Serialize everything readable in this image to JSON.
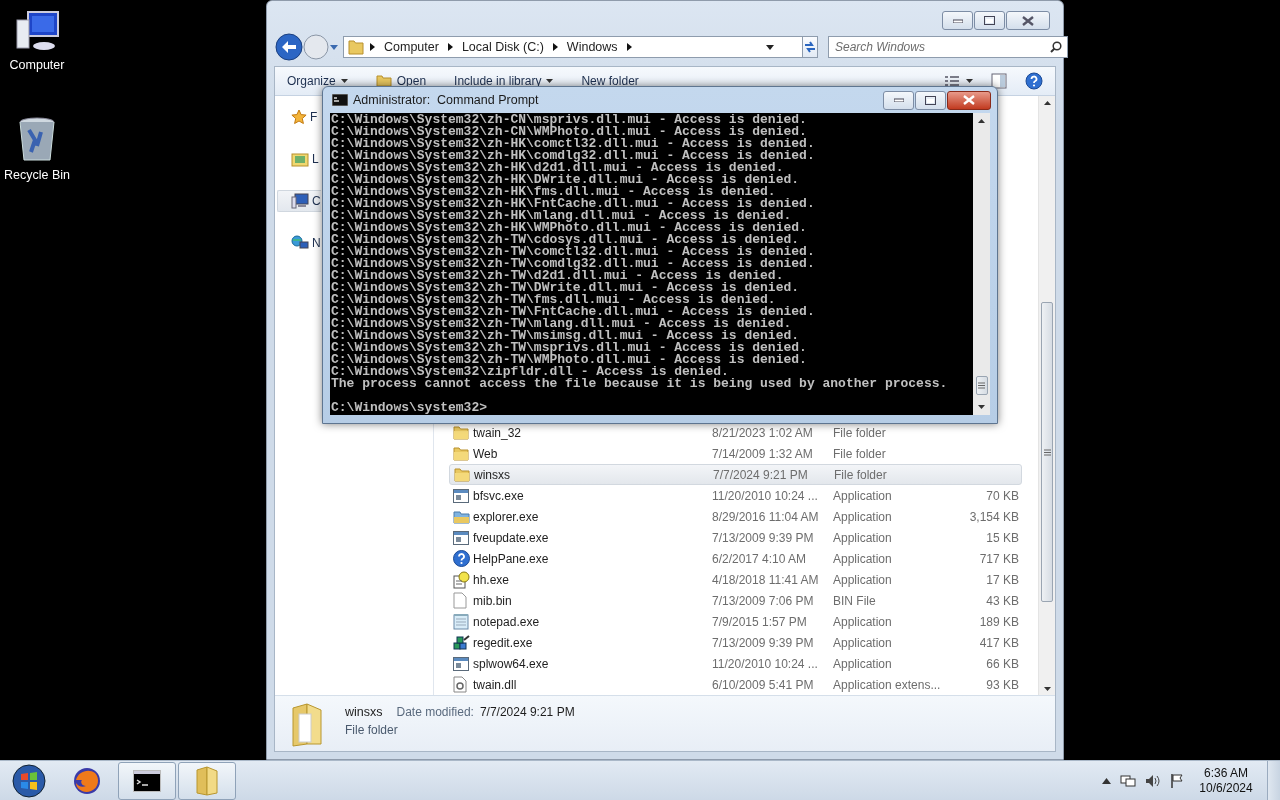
{
  "desktop": {
    "icons": [
      {
        "label": "Computer",
        "kind": "computer"
      },
      {
        "label": "Recycle Bin",
        "kind": "recycle"
      }
    ]
  },
  "explorer": {
    "breadcrumb": [
      "Computer",
      "Local Disk (C:)",
      "Windows"
    ],
    "search": {
      "placeholder": "Search Windows"
    },
    "toolbar": [
      {
        "label": "Organize",
        "kind": "menu"
      },
      {
        "label": "Open",
        "kind": "open"
      },
      {
        "label": "Include in library",
        "kind": "menu"
      },
      {
        "label": "New folder",
        "kind": "plain"
      }
    ],
    "nav": [
      {
        "label": "F",
        "kind": "favorites",
        "selected": false
      },
      {
        "label": "L",
        "kind": "libraries",
        "selected": false
      },
      {
        "label": "C",
        "kind": "computer",
        "selected": true
      },
      {
        "label": "N",
        "kind": "network",
        "selected": false
      }
    ],
    "files": [
      {
        "name": "twain_32",
        "date": "8/21/2023 1:02 AM",
        "type": "File folder",
        "kind": "folder",
        "selected": false
      },
      {
        "name": "Web",
        "date": "7/14/2009 1:32 AM",
        "type": "File folder",
        "kind": "folder",
        "selected": false
      },
      {
        "name": "winsxs",
        "date": "7/7/2024 9:21 PM",
        "type": "File folder",
        "kind": "folder",
        "selected": true
      },
      {
        "name": "bfsvc.exe",
        "date": "11/20/2010 10:24 ...",
        "type": "Application",
        "size": "70 KB",
        "kind": "app",
        "selected": false
      },
      {
        "name": "explorer.exe",
        "date": "8/29/2016 11:04 AM",
        "type": "Application",
        "size": "3,154 KB",
        "kind": "explorer",
        "selected": false
      },
      {
        "name": "fveupdate.exe",
        "date": "7/13/2009 9:39 PM",
        "type": "Application",
        "size": "15 KB",
        "kind": "app",
        "selected": false
      },
      {
        "name": "HelpPane.exe",
        "date": "6/2/2017 4:10 AM",
        "type": "Application",
        "size": "717 KB",
        "kind": "help",
        "selected": false
      },
      {
        "name": "hh.exe",
        "date": "4/18/2018 11:41 AM",
        "type": "Application",
        "size": "17 KB",
        "kind": "hh",
        "selected": false
      },
      {
        "name": "mib.bin",
        "date": "7/13/2009 7:06 PM",
        "type": "BIN File",
        "size": "43 KB",
        "kind": "file",
        "selected": false
      },
      {
        "name": "notepad.exe",
        "date": "7/9/2015 1:57 PM",
        "type": "Application",
        "size": "189 KB",
        "kind": "notepad",
        "selected": false
      },
      {
        "name": "regedit.exe",
        "date": "7/13/2009 9:39 PM",
        "type": "Application",
        "size": "417 KB",
        "kind": "regedit",
        "selected": false
      },
      {
        "name": "splwow64.exe",
        "date": "11/20/2010 10:24 ...",
        "type": "Application",
        "size": "66 KB",
        "kind": "app",
        "selected": false
      },
      {
        "name": "twain.dll",
        "date": "6/10/2009 5:41 PM",
        "type": "Application extens...",
        "size": "93 KB",
        "kind": "dll",
        "selected": false
      }
    ],
    "details": {
      "name": "winsxs",
      "date_label": "Date modified:",
      "date": "7/7/2024 9:21 PM",
      "type": "File folder"
    }
  },
  "console": {
    "title": "Administrator:  Command Prompt",
    "lines": [
      "C:\\Windows\\System32\\zh-CN\\msprivs.dll.mui - Access is denied.",
      "C:\\Windows\\System32\\zh-CN\\WMPhoto.dll.mui - Access is denied.",
      "C:\\Windows\\System32\\zh-HK\\comctl32.dll.mui - Access is denied.",
      "C:\\Windows\\System32\\zh-HK\\comdlg32.dll.mui - Access is denied.",
      "C:\\Windows\\System32\\zh-HK\\d2d1.dll.mui - Access is denied.",
      "C:\\Windows\\System32\\zh-HK\\DWrite.dll.mui - Access is denied.",
      "C:\\Windows\\System32\\zh-HK\\fms.dll.mui - Access is denied.",
      "C:\\Windows\\System32\\zh-HK\\FntCache.dll.mui - Access is denied.",
      "C:\\Windows\\System32\\zh-HK\\mlang.dll.mui - Access is denied.",
      "C:\\Windows\\System32\\zh-HK\\WMPhoto.dll.mui - Access is denied.",
      "C:\\Windows\\System32\\zh-TW\\cdosys.dll.mui - Access is denied.",
      "C:\\Windows\\System32\\zh-TW\\comctl32.dll.mui - Access is denied.",
      "C:\\Windows\\System32\\zh-TW\\comdlg32.dll.mui - Access is denied.",
      "C:\\Windows\\System32\\zh-TW\\d2d1.dll.mui - Access is denied.",
      "C:\\Windows\\System32\\zh-TW\\DWrite.dll.mui - Access is denied.",
      "C:\\Windows\\System32\\zh-TW\\fms.dll.mui - Access is denied.",
      "C:\\Windows\\System32\\zh-TW\\FntCache.dll.mui - Access is denied.",
      "C:\\Windows\\System32\\zh-TW\\mlang.dll.mui - Access is denied.",
      "C:\\Windows\\System32\\zh-TW\\msimsg.dll.mui - Access is denied.",
      "C:\\Windows\\System32\\zh-TW\\msprivs.dll.mui - Access is denied.",
      "C:\\Windows\\System32\\zh-TW\\WMPhoto.dll.mui - Access is denied.",
      "C:\\Windows\\System32\\zipfldr.dll - Access is denied.",
      "The process cannot access the file because it is being used by another process."
    ],
    "prompt": "C:\\Windows\\system32>"
  },
  "taskbar": {
    "apps": [
      {
        "kind": "firefox",
        "open": false
      },
      {
        "kind": "cmd",
        "open": true
      },
      {
        "kind": "explorer",
        "open": true
      }
    ],
    "clock": {
      "time": "6:36 AM",
      "date": "10/6/2024"
    }
  }
}
